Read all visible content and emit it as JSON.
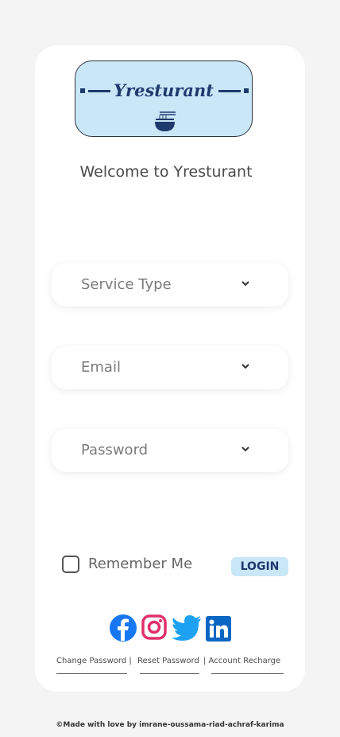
{
  "logo": {
    "text": "Yresturant"
  },
  "welcome": "Welcome to Yresturant",
  "fields": {
    "service": "Service Type",
    "email": "Email",
    "password": "Password"
  },
  "remember_me": "Remember Me",
  "login": "LOGIN",
  "social": [
    "facebook-icon",
    "instagram-icon",
    "twitter-icon",
    "linkedin-icon"
  ],
  "links": {
    "change_password": "Change Password |",
    "reset_password": "Reset Password",
    "account_recharge": "| Account Recharge"
  },
  "footer": "©Made with love by  imrane-oussama-riad-achraf-karima",
  "colors": {
    "accent": "#c8e7f7",
    "brand_text": "#1e3a6e",
    "facebook": "#1877f2",
    "instagram": "#e1306c",
    "twitter": "#1da1f2",
    "linkedin": "#0a66c2"
  }
}
